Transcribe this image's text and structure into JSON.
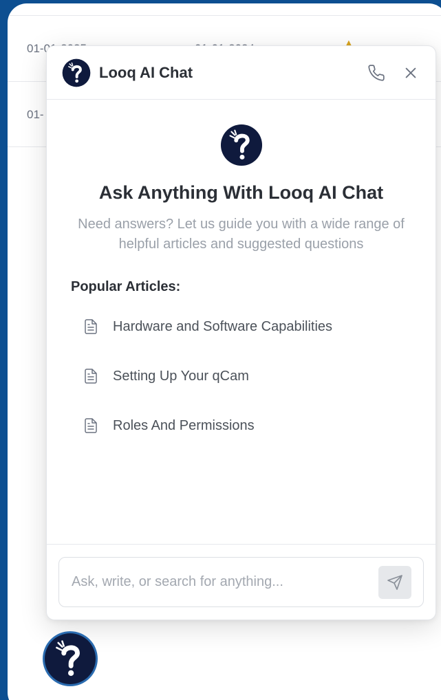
{
  "background_rows": [
    {
      "col1": "01-01-2025",
      "col2": "01-01-2024"
    },
    {
      "col1": "01-",
      "col2": ""
    }
  ],
  "chat": {
    "title": "Looq AI Chat",
    "logo_icon": "question-mark-logo-icon",
    "header_actions": [
      "phone-icon",
      "close-icon"
    ],
    "welcome_title": "Ask Anything With Looq AI Chat",
    "welcome_subtitle": "Need answers? Let us guide you with a wide range of helpful articles and suggested questions",
    "popular_heading": "Popular Articles:",
    "articles": [
      {
        "label": "Hardware and Software Capabilities",
        "icon": "document-icon"
      },
      {
        "label": "Setting Up Your qCam",
        "icon": "document-icon"
      },
      {
        "label": "Roles And Permissions",
        "icon": "document-icon"
      }
    ],
    "input": {
      "placeholder": "Ask, write, or search for anything...",
      "value": ""
    },
    "send_icon": "send-icon"
  },
  "colors": {
    "page_background": "#0d4f91",
    "logo_background": "#0f1a3d",
    "fab_ring": "#2b6cb0",
    "accent_star": "#d9a520"
  }
}
